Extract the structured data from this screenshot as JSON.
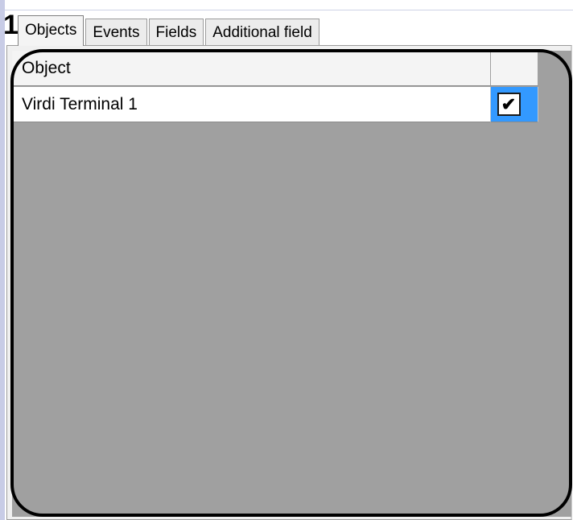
{
  "callout": {
    "number": "1"
  },
  "tabs": [
    {
      "label": "Objects",
      "active": true
    },
    {
      "label": "Events",
      "active": false
    },
    {
      "label": "Fields",
      "active": false
    },
    {
      "label": "Additional field",
      "active": false
    }
  ],
  "grid": {
    "columns": [
      {
        "label": "Object"
      },
      {
        "label": ""
      }
    ],
    "rows": [
      {
        "object": "Virdi Terminal 1",
        "checked": true,
        "check_mark": "✔"
      }
    ]
  },
  "colors": {
    "grid_background": "#a0a0a0",
    "selection": "#3399ff",
    "callout_frame": "#000000"
  }
}
